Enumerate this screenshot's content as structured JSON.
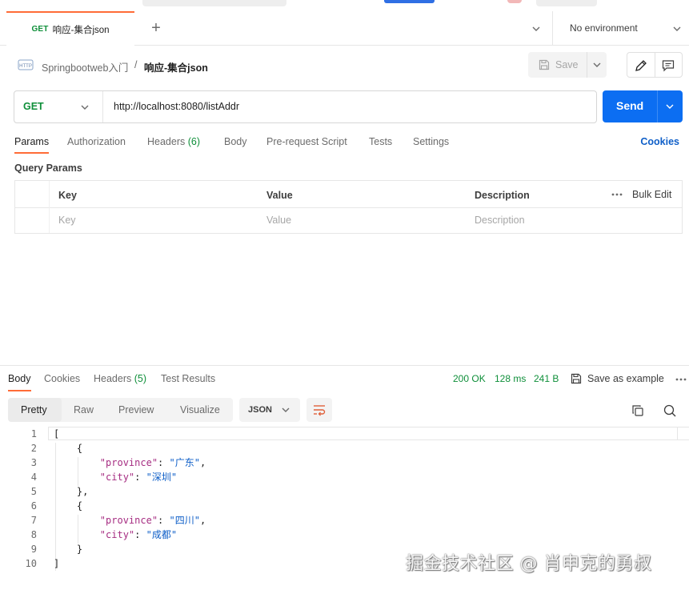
{
  "tabs": [
    {
      "method": "GET",
      "name": "响应-集合json"
    }
  ],
  "environment": {
    "selected": "No environment"
  },
  "breadcrumb": {
    "parent": "Springbootweb入门",
    "separator": "/",
    "current": "响应-集合json"
  },
  "toolbar": {
    "save_label": "Save"
  },
  "request": {
    "method": "GET",
    "url": "http://localhost:8080/listAddr",
    "send_label": "Send"
  },
  "request_tabs": [
    {
      "label": "Params"
    },
    {
      "label": "Authorization"
    },
    {
      "label": "Headers",
      "count": "(6)"
    },
    {
      "label": "Body"
    },
    {
      "label": "Pre-request Script"
    },
    {
      "label": "Tests"
    },
    {
      "label": "Settings"
    }
  ],
  "cookies_label": "Cookies",
  "query_params": {
    "title": "Query Params",
    "headers": [
      "Key",
      "Value",
      "Description"
    ],
    "bulk_edit": "Bulk Edit",
    "placeholders": [
      "Key",
      "Value",
      "Description"
    ]
  },
  "response_tabs": [
    {
      "label": "Body"
    },
    {
      "label": "Cookies"
    },
    {
      "label": "Headers",
      "count": "(5)"
    },
    {
      "label": "Test Results"
    }
  ],
  "response_status": {
    "status": "200 OK",
    "time": "128 ms",
    "size": "241 B"
  },
  "save_as_example": "Save as example",
  "view_modes": [
    "Pretty",
    "Raw",
    "Preview",
    "Visualize"
  ],
  "format": "JSON",
  "code_lines": [
    {
      "n": "1",
      "text": "["
    },
    {
      "n": "2",
      "text": "    {"
    },
    {
      "n": "3",
      "key": "\"province\"",
      "value": "\"广东\"",
      "indent": "        ",
      "trail": ","
    },
    {
      "n": "4",
      "key": "\"city\"",
      "value": "\"深圳\"",
      "indent": "        ",
      "trail": ""
    },
    {
      "n": "5",
      "text": "    },"
    },
    {
      "n": "6",
      "text": "    {"
    },
    {
      "n": "7",
      "key": "\"province\"",
      "value": "\"四川\"",
      "indent": "        ",
      "trail": ","
    },
    {
      "n": "8",
      "key": "\"city\"",
      "value": "\"成都\"",
      "indent": "        ",
      "trail": ""
    },
    {
      "n": "9",
      "text": "    }"
    },
    {
      "n": "10",
      "text": "]"
    }
  ],
  "watermark": "掘金技术社区 @ 肖申克的勇叔"
}
